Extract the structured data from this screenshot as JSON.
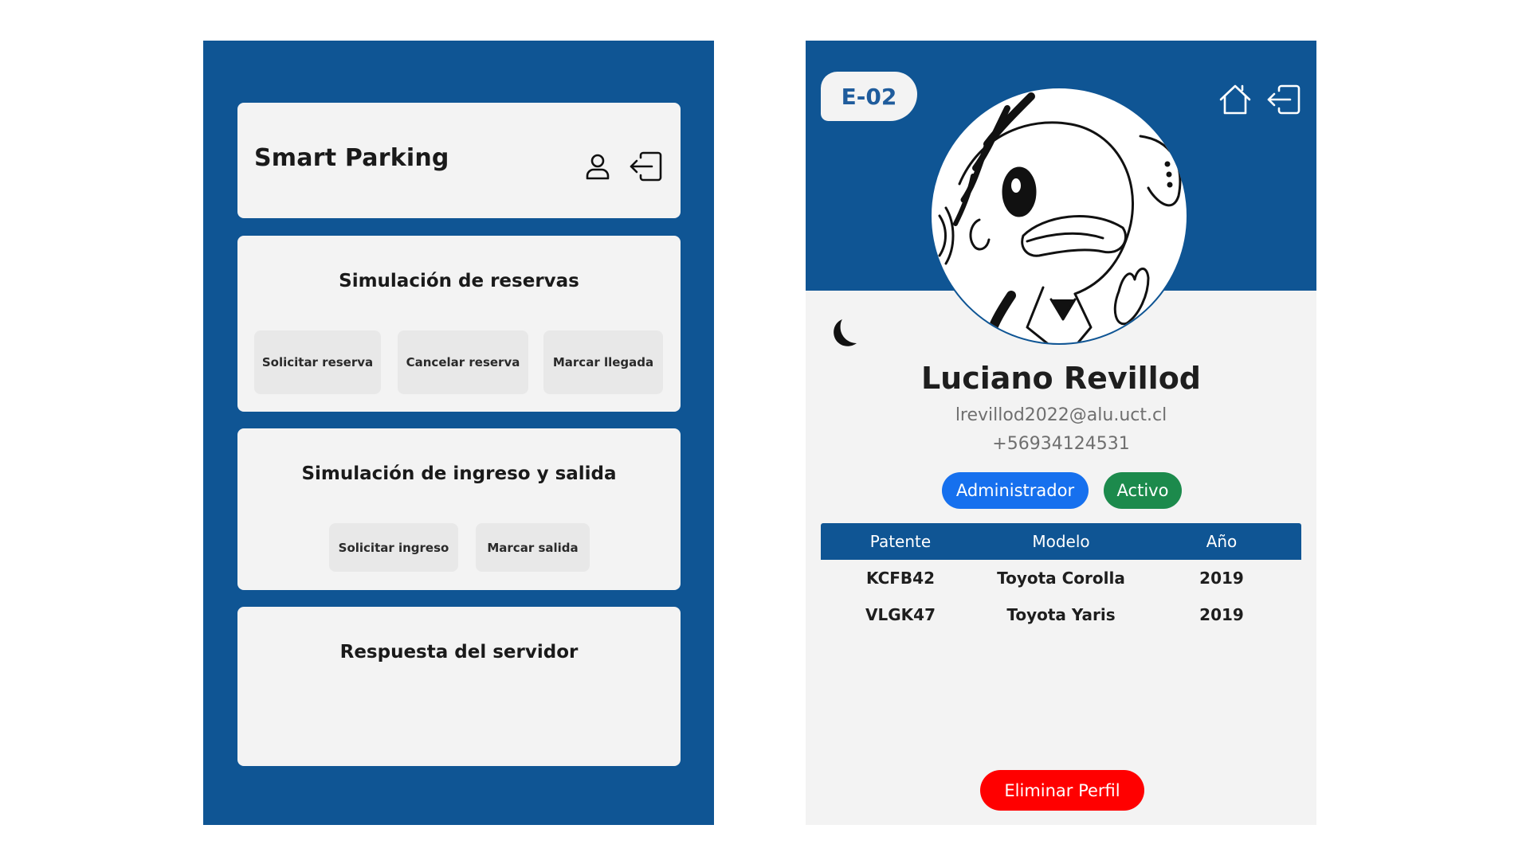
{
  "left_screen": {
    "header": {
      "title": "Smart Parking",
      "user_icon": "user-icon",
      "logout_icon": "logout-icon"
    },
    "reservas": {
      "title": "Simulación de reservas",
      "buttons": [
        "Solicitar reserva",
        "Cancelar reserva",
        "Marcar llegada"
      ]
    },
    "ingreso": {
      "title": "Simulación de ingreso y salida",
      "buttons": [
        "Solicitar ingreso",
        "Marcar salida"
      ]
    },
    "respuesta": {
      "title": "Respuesta del servidor"
    }
  },
  "right_screen": {
    "space_tag": "E-02",
    "icons": [
      "home-icon",
      "logout-icon",
      "moon-icon"
    ],
    "profile": {
      "name": "Luciano Revillod",
      "email": "lrevillod2022@alu.uct.cl",
      "phone": "+56934124531",
      "role": "Administrador",
      "status": "Activo"
    },
    "vehicles": {
      "headers": [
        "Patente",
        "Modelo",
        "Año"
      ],
      "rows": [
        [
          "KCFB42",
          "Toyota Corolla",
          "2019"
        ],
        [
          "VLGK47",
          "Toyota Yaris",
          "2019"
        ]
      ]
    },
    "delete_label": "Eliminar Perfil"
  },
  "colors": {
    "primary_blue": "#0f5594",
    "card_bg": "#f3f3f3",
    "role_badge": "#1670ee",
    "status_badge": "#1c8a4c",
    "danger": "#ff0000"
  }
}
